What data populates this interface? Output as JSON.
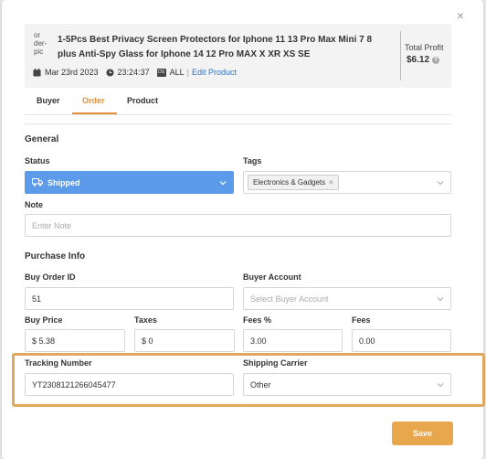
{
  "header": {
    "thumb_alt": "or der-pic",
    "title": "1-5Pcs Best Privacy Screen Protectors for Iphone 11 13 Pro Max Mini 7 8 plus Anti-Spy Glass for Iphone 14 12 Pro MAX X XR XS SE",
    "date": "Mar 23rd 2023",
    "time": "23:24:37",
    "store_badge": "DS",
    "store": "ALL",
    "edit_link": "Edit Product",
    "profit_label": "Total Profit",
    "profit_value": "$6.12"
  },
  "tabs": [
    {
      "label": "Buyer",
      "active": false
    },
    {
      "label": "Order",
      "active": true
    },
    {
      "label": "Product",
      "active": false
    }
  ],
  "general": {
    "heading": "General",
    "status_label": "Status",
    "status_value": "Shipped",
    "tags_label": "Tags",
    "tag": "Electronics & Gadgets",
    "note_label": "Note",
    "note_placeholder": "Enter Note"
  },
  "purchase": {
    "heading": "Purchase Info",
    "buy_order_id_label": "Buy Order ID",
    "buy_order_id": "51",
    "buyer_account_label": "Buyer Account",
    "buyer_account_placeholder": "Select Buyer Account",
    "buy_price_label": "Buy Price",
    "buy_price": "$ 5.38",
    "taxes_label": "Taxes",
    "taxes": "$ 0",
    "fees_pct_label": "Fees %",
    "fees_pct": "3.00",
    "fees_label": "Fees",
    "fees": "0.00",
    "tracking_label": "Tracking Number",
    "tracking": "YT2308121266045477",
    "carrier_label": "Shipping Carrier",
    "carrier": "Other"
  },
  "actions": {
    "save": "Save"
  },
  "colors": {
    "accent": "#e0913a",
    "status_bg": "#5b9bea",
    "highlight": "#e0a85e",
    "save_bg": "#e8a64d"
  }
}
